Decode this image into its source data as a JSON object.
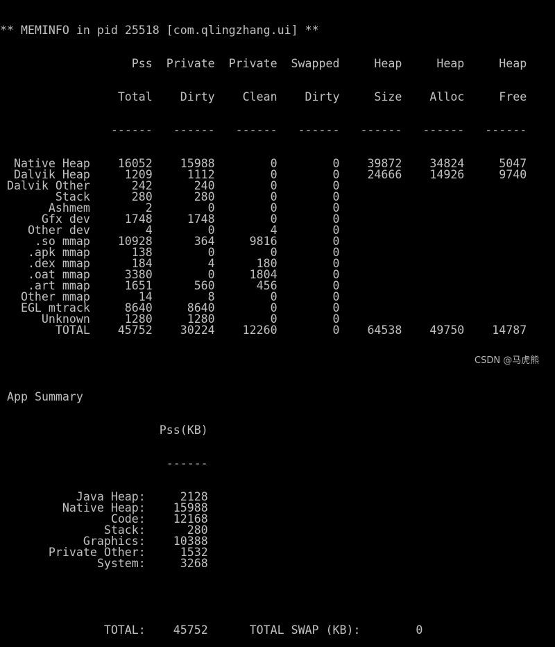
{
  "title": "** MEMINFO in pid 25518 [com.qlingzhang.ui] **",
  "columns": {
    "header1": [
      "Pss",
      "Private",
      "Private",
      "Swapped",
      "Heap",
      "Heap",
      "Heap"
    ],
    "header2": [
      "Total",
      "Dirty",
      "Clean",
      "Dirty",
      "Size",
      "Alloc",
      "Free"
    ],
    "separator": "------"
  },
  "rows": [
    {
      "label": "Native Heap",
      "values": [
        "16052",
        "15988",
        "0",
        "0",
        "39872",
        "34824",
        "5047"
      ]
    },
    {
      "label": "Dalvik Heap",
      "values": [
        "1209",
        "1112",
        "0",
        "0",
        "24666",
        "14926",
        "9740"
      ]
    },
    {
      "label": "Dalvik Other",
      "values": [
        "242",
        "240",
        "0",
        "0"
      ]
    },
    {
      "label": "Stack",
      "values": [
        "280",
        "280",
        "0",
        "0"
      ]
    },
    {
      "label": "Ashmem",
      "values": [
        "2",
        "0",
        "0",
        "0"
      ]
    },
    {
      "label": "Gfx dev",
      "values": [
        "1748",
        "1748",
        "0",
        "0"
      ]
    },
    {
      "label": "Other dev",
      "values": [
        "4",
        "0",
        "4",
        "0"
      ]
    },
    {
      "label": ".so mmap",
      "values": [
        "10928",
        "364",
        "9816",
        "0"
      ]
    },
    {
      "label": ".apk mmap",
      "values": [
        "138",
        "0",
        "0",
        "0"
      ]
    },
    {
      "label": ".dex mmap",
      "values": [
        "184",
        "4",
        "180",
        "0"
      ]
    },
    {
      "label": ".oat mmap",
      "values": [
        "3380",
        "0",
        "1804",
        "0"
      ]
    },
    {
      "label": ".art mmap",
      "values": [
        "1651",
        "560",
        "456",
        "0"
      ]
    },
    {
      "label": "Other mmap",
      "values": [
        "14",
        "8",
        "0",
        "0"
      ]
    },
    {
      "label": "EGL mtrack",
      "values": [
        "8640",
        "8640",
        "0",
        "0"
      ]
    },
    {
      "label": "Unknown",
      "values": [
        "1280",
        "1280",
        "0",
        "0"
      ]
    },
    {
      "label": "TOTAL",
      "values": [
        "45752",
        "30224",
        "12260",
        "0",
        "64538",
        "49750",
        "14787"
      ]
    }
  ],
  "summary": {
    "title": "App Summary",
    "column_header": "Pss(KB)",
    "separator": "------",
    "items": [
      {
        "label": "Java Heap:",
        "value": "2128"
      },
      {
        "label": "Native Heap:",
        "value": "15988"
      },
      {
        "label": "Code:",
        "value": "12168"
      },
      {
        "label": "Stack:",
        "value": "280"
      },
      {
        "label": "Graphics:",
        "value": "10388"
      },
      {
        "label": "Private Other:",
        "value": "1532"
      },
      {
        "label": "System:",
        "value": "3268"
      }
    ],
    "total_label": "TOTAL:",
    "total_value": "45752",
    "swap_label": "TOTAL SWAP (KB):",
    "swap_value": "0"
  },
  "watermark": "CSDN @马虎熊",
  "colors": {
    "background": "#000000",
    "text": "#c0c0c0"
  }
}
